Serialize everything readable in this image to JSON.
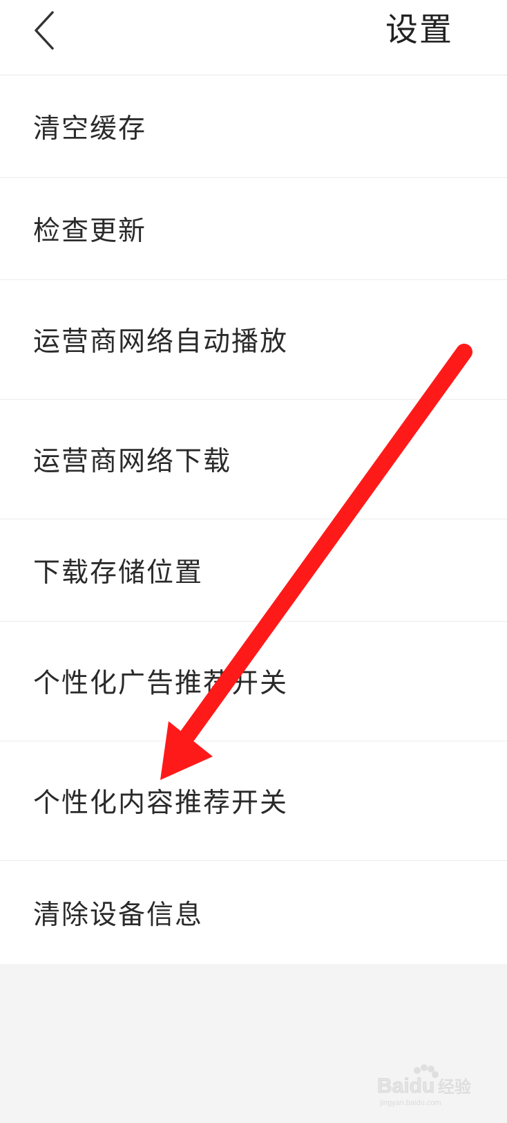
{
  "header": {
    "title": "设置",
    "back_icon": "chevron-left-icon"
  },
  "settings": {
    "items": [
      {
        "label": "清空缓存"
      },
      {
        "label": "检查更新"
      },
      {
        "label": "运营商网络自动播放"
      },
      {
        "label": "运营商网络下载"
      },
      {
        "label": "下载存储位置"
      },
      {
        "label": "个性化广告推荐开关"
      },
      {
        "label": "个性化内容推荐开关"
      },
      {
        "label": "清除设备信息"
      }
    ]
  },
  "annotation": {
    "arrow_color": "#ff1a1a",
    "arrow_icon": "red-arrow-annotation"
  },
  "watermark": {
    "text": "Baidu经验",
    "subtext": "jingyan.baidu.com"
  },
  "colors": {
    "background": "#f4f4f4",
    "surface": "#ffffff",
    "text": "#2a2a2a",
    "divider": "#ececec"
  }
}
